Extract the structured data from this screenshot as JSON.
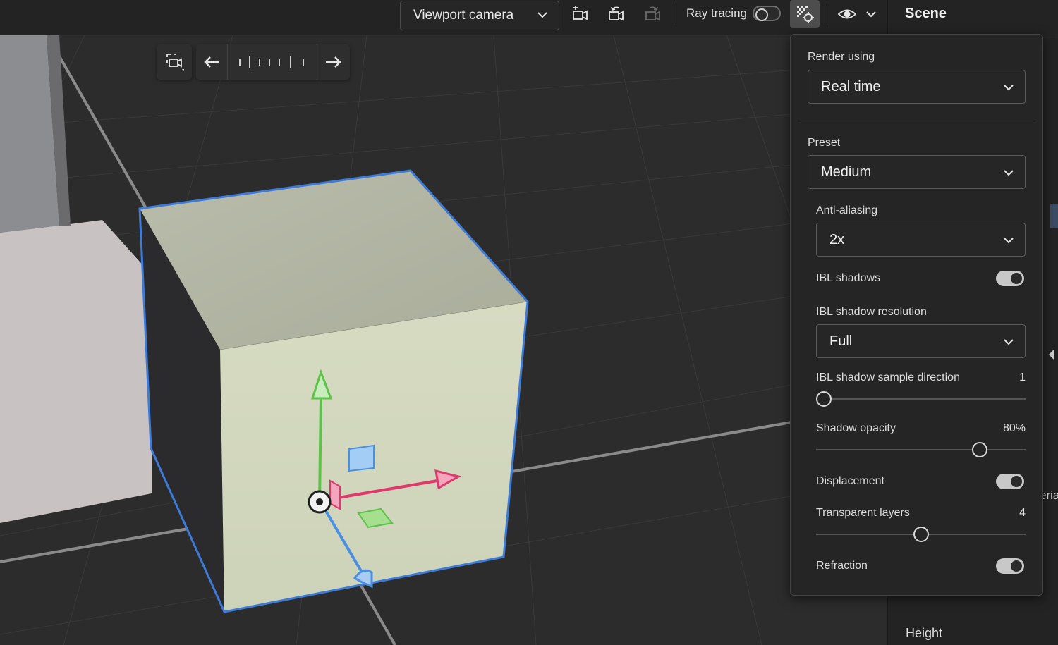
{
  "toolbar": {
    "camera_select": "Viewport camera",
    "ray_tracing_label": "Ray tracing",
    "ray_tracing_on": false,
    "panel_title": "Scene",
    "icons": [
      "add-camera-icon",
      "camera-undo-icon",
      "camera-redo-icon",
      "render-settings-icon",
      "eye-icon",
      "chevron-down-icon"
    ]
  },
  "history_bar": {
    "icons": [
      "camera-frame-icon",
      "arrow-left-icon",
      "timeline-icon",
      "arrow-right-icon"
    ]
  },
  "render_settings": {
    "render_using_label": "Render using",
    "render_using_value": "Real time",
    "preset_label": "Preset",
    "preset_value": "Medium",
    "anti_aliasing_label": "Anti-aliasing",
    "anti_aliasing_value": "2x",
    "ibl_shadows_label": "IBL shadows",
    "ibl_shadows_on": true,
    "ibl_shadow_resolution_label": "IBL shadow resolution",
    "ibl_shadow_resolution_value": "Full",
    "ibl_sample_direction_label": "IBL shadow sample direction",
    "ibl_sample_direction_value": "1",
    "ibl_sample_direction_fraction": 0.0,
    "shadow_opacity_label": "Shadow opacity",
    "shadow_opacity_value": "80%",
    "shadow_opacity_fraction": 0.78,
    "displacement_label": "Displacement",
    "displacement_on": true,
    "transparent_layers_label": "Transparent layers",
    "transparent_layers_value": "4",
    "transparent_layers_fraction": 0.5,
    "refraction_label": "Refraction",
    "refraction_on": true
  },
  "right_panel": {
    "height_label": "Height",
    "partial_label": "eria"
  },
  "colors": {
    "accent_selection": "#3d7bd9",
    "gizmo_y": "#5cc24a",
    "gizmo_x": "#e0386b",
    "gizmo_z": "#4a90e2"
  }
}
